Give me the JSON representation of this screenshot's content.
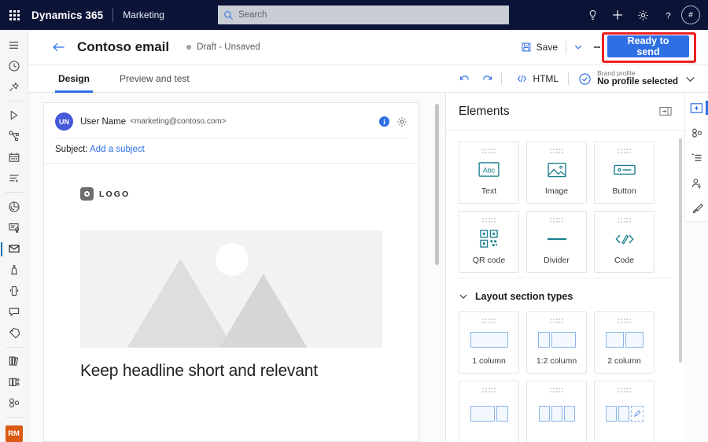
{
  "suite": {
    "waffle_icon": "waffle-grid-icon",
    "brand": "Dynamics 365",
    "app_name": "Marketing",
    "search": {
      "placeholder": "Search",
      "icon": "search-icon"
    },
    "actions": [
      {
        "name": "lightbulb-icon",
        "label": "Insights"
      },
      {
        "name": "plus-icon",
        "label": "New"
      },
      {
        "name": "gear-icon",
        "label": "Settings"
      },
      {
        "name": "question-icon",
        "label": "Help"
      }
    ],
    "avatar": "#"
  },
  "left_rail": {
    "items": [
      {
        "name": "hamburger-icon",
        "label": "Show menu",
        "active": false
      },
      {
        "name": "clock-icon",
        "label": "Recent",
        "active": false
      },
      {
        "name": "pin-icon",
        "label": "Pinned",
        "active": false
      },
      {
        "name": "play-icon",
        "label": "Journeys",
        "active": false
      },
      {
        "name": "journey-icon",
        "label": "Customer journeys",
        "active": false
      },
      {
        "name": "calendar-icon",
        "label": "Calendar",
        "active": false
      },
      {
        "name": "segment-icon",
        "label": "Segments",
        "active": false
      },
      {
        "name": "analytics-icon",
        "label": "Analytics",
        "active": false
      },
      {
        "name": "certificate-icon",
        "label": "Content",
        "active": false
      },
      {
        "name": "envelope-icon",
        "label": "Emails",
        "active": true
      },
      {
        "name": "form-icon",
        "label": "Forms",
        "active": false
      },
      {
        "name": "mobile-icon",
        "label": "Text messages",
        "active": false
      },
      {
        "name": "chat-icon",
        "label": "Push notifications",
        "active": false
      },
      {
        "name": "tag-icon",
        "label": "Tags",
        "active": false
      },
      {
        "name": "library-icon",
        "label": "Library",
        "active": false
      },
      {
        "name": "columns-icon",
        "label": "Templates",
        "active": false
      },
      {
        "name": "people-icon",
        "label": "Audience",
        "active": false
      }
    ],
    "badge": "RM"
  },
  "command_bar": {
    "back_icon": "back-arrow-icon",
    "title": "Contoso email",
    "status": "Draft - Unsaved",
    "save_label": "Save",
    "save_icon": "save-icon",
    "caret_icon": "chevron-down-icon",
    "more_icon": "more-vertical-icon",
    "primary_label": "Ready to send"
  },
  "toolbar": {
    "tabs": [
      {
        "label": "Design",
        "active": true
      },
      {
        "label": "Preview and test",
        "active": false
      }
    ],
    "undo_icon": "undo-icon",
    "redo_icon": "redo-icon",
    "html_label": "HTML",
    "html_icon": "code-icon",
    "brand_profile": {
      "icon": "brand-check-icon",
      "label": "Brand profile",
      "value": "No profile selected",
      "caret_icon": "chevron-down-icon"
    }
  },
  "email": {
    "avatar_initials": "UN",
    "sender_name": "User Name",
    "sender_email": "<marketing@contoso.com>",
    "info_icon": "info-icon",
    "settings_icon": "gear-icon",
    "subject_label": "Subject:",
    "subject_placeholder": "Add a subject",
    "logo_text": "LOGO",
    "logo_icon": "logo-placeholder-icon",
    "hero_icon": "image-placeholder-icon",
    "headline": "Keep headline short and relevant"
  },
  "elements_panel": {
    "title": "Elements",
    "collapse_icon": "collapse-panel-icon",
    "elements": [
      {
        "label": "Text",
        "icon": "text-abc-icon"
      },
      {
        "label": "Image",
        "icon": "image-icon"
      },
      {
        "label": "Button",
        "icon": "button-icon"
      },
      {
        "label": "QR code",
        "icon": "qr-code-icon"
      },
      {
        "label": "Divider",
        "icon": "divider-icon"
      },
      {
        "label": "Code",
        "icon": "code-snippet-icon"
      }
    ],
    "layout_section": {
      "title": "Layout section types",
      "chevron_icon": "chevron-down-icon",
      "layouts": [
        {
          "label": "1 column",
          "icon": "layout-1-column-icon"
        },
        {
          "label": "1:2 column",
          "icon": "layout-1-2-column-icon"
        },
        {
          "label": "2 column",
          "icon": "layout-2-column-icon"
        },
        {
          "label": "",
          "icon": "layout-2-1-column-icon"
        },
        {
          "label": "",
          "icon": "layout-3-column-icon"
        },
        {
          "label": "",
          "icon": "layout-custom-icon"
        }
      ]
    }
  },
  "right_rail": {
    "items": [
      {
        "name": "add-element-icon",
        "label": "Elements",
        "active": true
      },
      {
        "name": "connections-icon",
        "label": "Connections",
        "active": false
      },
      {
        "name": "list-icon",
        "label": "Navigator",
        "active": false
      },
      {
        "name": "personalization-icon",
        "label": "Personalization",
        "active": false
      },
      {
        "name": "brush-icon",
        "label": "Styles",
        "active": false
      }
    ]
  },
  "colors": {
    "suite_bg": "#0b1437",
    "accent": "#2f6fe4",
    "highlight": "#f02020",
    "element_icon": "#1a7f8e",
    "badge": "#d8590f"
  }
}
